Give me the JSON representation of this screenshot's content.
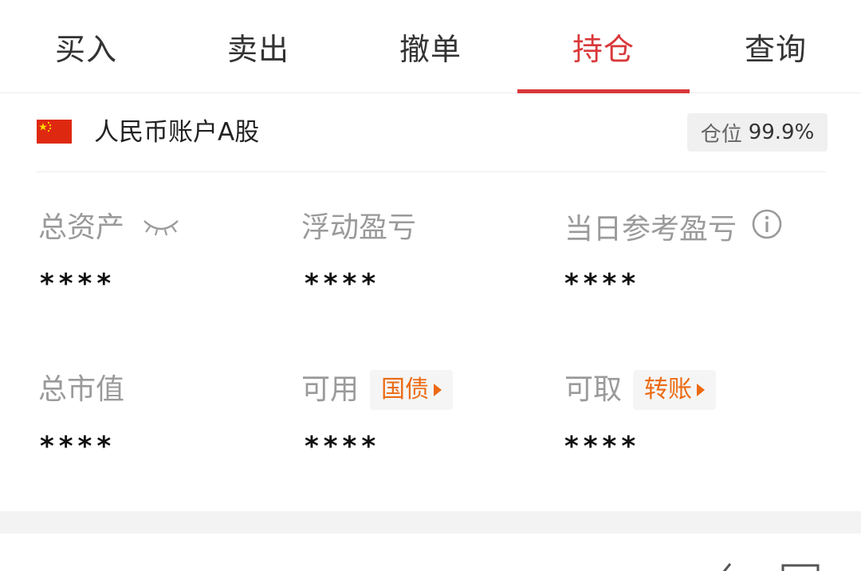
{
  "tabs": [
    {
      "label": "买入"
    },
    {
      "label": "卖出"
    },
    {
      "label": "撤单"
    },
    {
      "label": "持仓",
      "active": true
    },
    {
      "label": "查询"
    }
  ],
  "account": {
    "flag_icon": "china-flag-icon",
    "name": "人民币账户A股",
    "position_label": "仓位",
    "position_value": "99.9%"
  },
  "metrics": {
    "total_assets": {
      "label": "总资产",
      "value": "****",
      "icon": "eye-closed-icon"
    },
    "floating_pnl": {
      "label": "浮动盈亏",
      "value": "****"
    },
    "daily_pnl": {
      "label": "当日参考盈亏",
      "value": "****",
      "icon": "info-icon"
    },
    "market_value": {
      "label": "总市值",
      "value": "****"
    },
    "available": {
      "label": "可用",
      "value": "****",
      "action": "国债"
    },
    "withdrawable": {
      "label": "可取",
      "value": "****",
      "action": "转账"
    }
  },
  "colors": {
    "accent": "#d9383a",
    "action": "#ec6a12",
    "muted": "#9a9a9a"
  }
}
